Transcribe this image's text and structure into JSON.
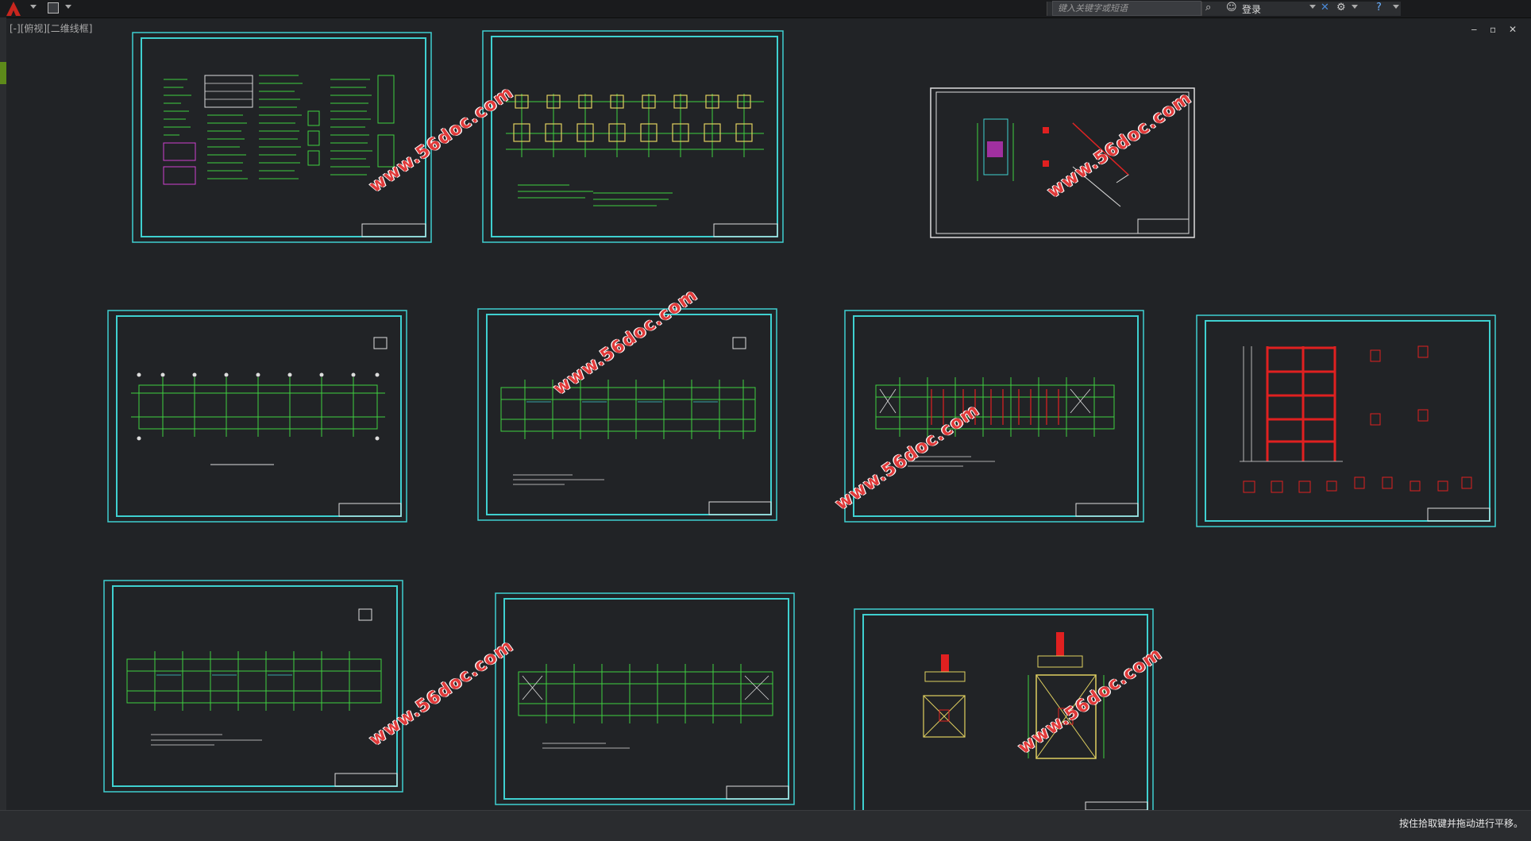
{
  "titlebar": {
    "search_placeholder": "键入关键字或短语",
    "login_label": "登录"
  },
  "viewport": {
    "label": "[-][俯视][二维线框]",
    "window_controls": "‒ ▫ ✕"
  },
  "status_bar": {
    "message": "按住拾取键并拖动进行平移。"
  },
  "watermark_text": "www.56doc.com",
  "colors": {
    "background": "#212326",
    "frame": "#3fd0d0",
    "grid": "#40d040",
    "column": "#e0d060",
    "rebar": "#e02020",
    "watermark": "#e03a3a"
  },
  "icons": [
    "autocad-logo-icon",
    "save-icon",
    "binoculars-icon",
    "user-icon",
    "exchange-icon",
    "network-icon",
    "help-icon"
  ]
}
